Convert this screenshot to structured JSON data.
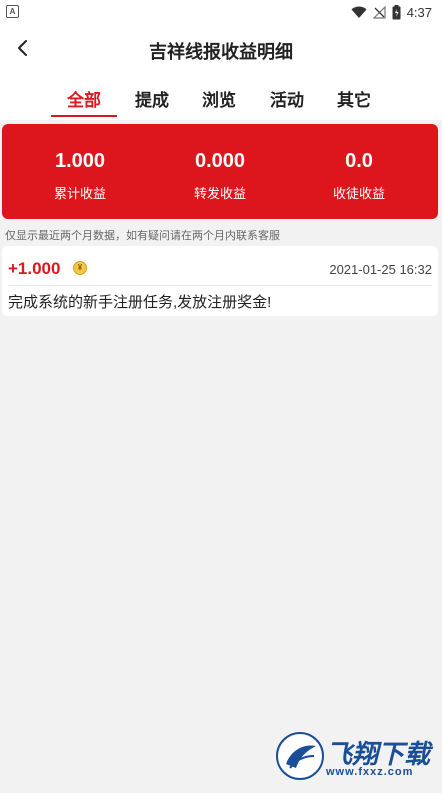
{
  "status_bar": {
    "time": "4:37"
  },
  "header": {
    "title": "吉祥线报收益明细"
  },
  "tabs": [
    {
      "label": "全部",
      "active": true
    },
    {
      "label": "提成",
      "active": false
    },
    {
      "label": "浏览",
      "active": false
    },
    {
      "label": "活动",
      "active": false
    },
    {
      "label": "其它",
      "active": false
    }
  ],
  "summary": {
    "items": [
      {
        "value": "1.000",
        "label": "累计收益"
      },
      {
        "value": "0.000",
        "label": "转发收益"
      },
      {
        "value": "0.0",
        "label": "收徒收益"
      }
    ]
  },
  "notice": "仅显示最近两个月数据，如有疑问请在两个月内联系客服",
  "records": [
    {
      "amount": "+1.000",
      "coin_symbol": "¥",
      "timestamp": "2021-01-25 16:32",
      "description": "完成系统的新手注册任务,发放注册奖金!"
    }
  ],
  "watermark": {
    "brand": "飞翔下载",
    "url": "www.fxxz.com"
  },
  "colors": {
    "accent": "#d71b1f",
    "summary_bg": "#dd151c",
    "background": "#f2f2f2"
  }
}
